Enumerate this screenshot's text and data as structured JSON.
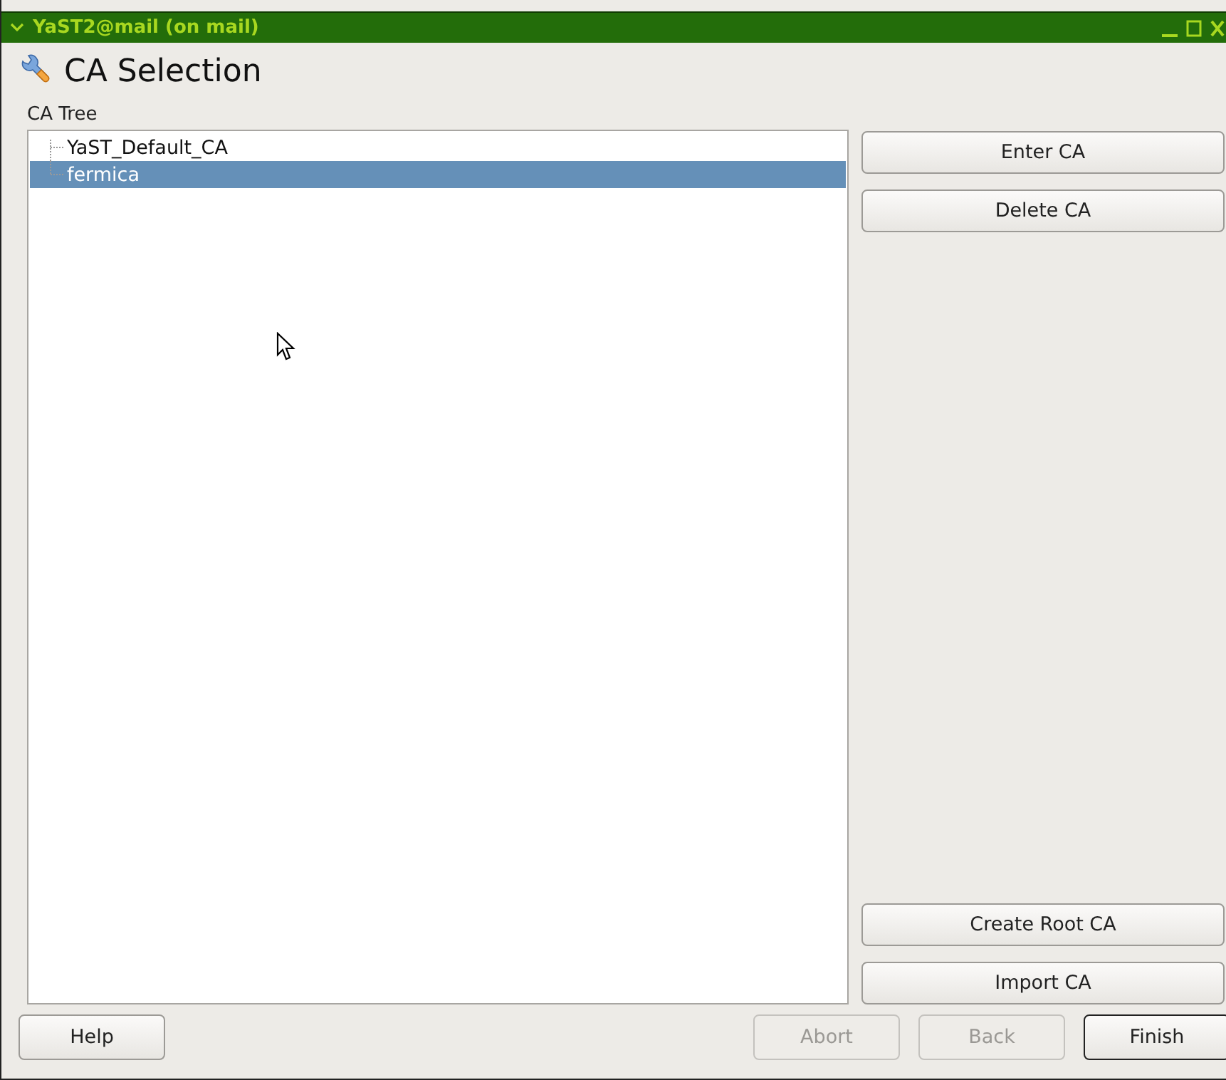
{
  "window": {
    "title": "YaST2@mail (on mail)"
  },
  "heading": "CA Selection",
  "tree": {
    "label": "CA Tree",
    "items": [
      {
        "label": "YaST_Default_CA",
        "selected": false
      },
      {
        "label": "fermica",
        "selected": true
      }
    ]
  },
  "side_buttons_top": [
    {
      "label": "Enter CA",
      "disabled": false
    },
    {
      "label": "Delete CA",
      "disabled": false
    }
  ],
  "side_buttons_bottom": [
    {
      "label": "Create Root CA",
      "disabled": false
    },
    {
      "label": "Import CA",
      "disabled": false
    }
  ],
  "help_button": {
    "label": "Help",
    "disabled": false
  },
  "nav_buttons": [
    {
      "label": "Abort",
      "disabled": true,
      "default": false
    },
    {
      "label": "Back",
      "disabled": true,
      "default": false
    },
    {
      "label": "Finish",
      "disabled": false,
      "default": true
    }
  ]
}
